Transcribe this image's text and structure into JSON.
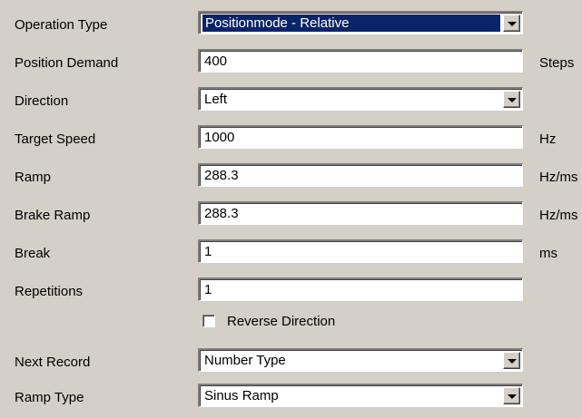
{
  "fields": [
    {
      "label": "Operation Type",
      "value": "Positionmode - Relative",
      "kind": "select",
      "focused": true,
      "unit": ""
    },
    {
      "label": "Position Demand",
      "value": "400",
      "kind": "input",
      "unit": "Steps"
    },
    {
      "label": "Direction",
      "value": "Left",
      "kind": "select",
      "unit": ""
    },
    {
      "label": "Target Speed",
      "value": "1000",
      "kind": "input",
      "unit": "Hz"
    },
    {
      "label": "Ramp",
      "value": "288.3",
      "kind": "input",
      "unit": "Hz/ms"
    },
    {
      "label": "Brake Ramp",
      "value": "288.3",
      "kind": "input",
      "unit": "Hz/ms"
    },
    {
      "label": "Break",
      "value": "1",
      "kind": "input",
      "unit": "ms"
    },
    {
      "label": "Repetitions",
      "value": "1",
      "kind": "input",
      "unit": ""
    }
  ],
  "reverse_direction": {
    "label": "Reverse Direction",
    "checked": false
  },
  "next_record": {
    "label": "Next Record",
    "value": "Number Type"
  },
  "ramp_type": {
    "label": "Ramp Type",
    "value": "Sinus Ramp"
  },
  "colors": {
    "background": "#d4d0c8",
    "selection": "#0a246a"
  }
}
